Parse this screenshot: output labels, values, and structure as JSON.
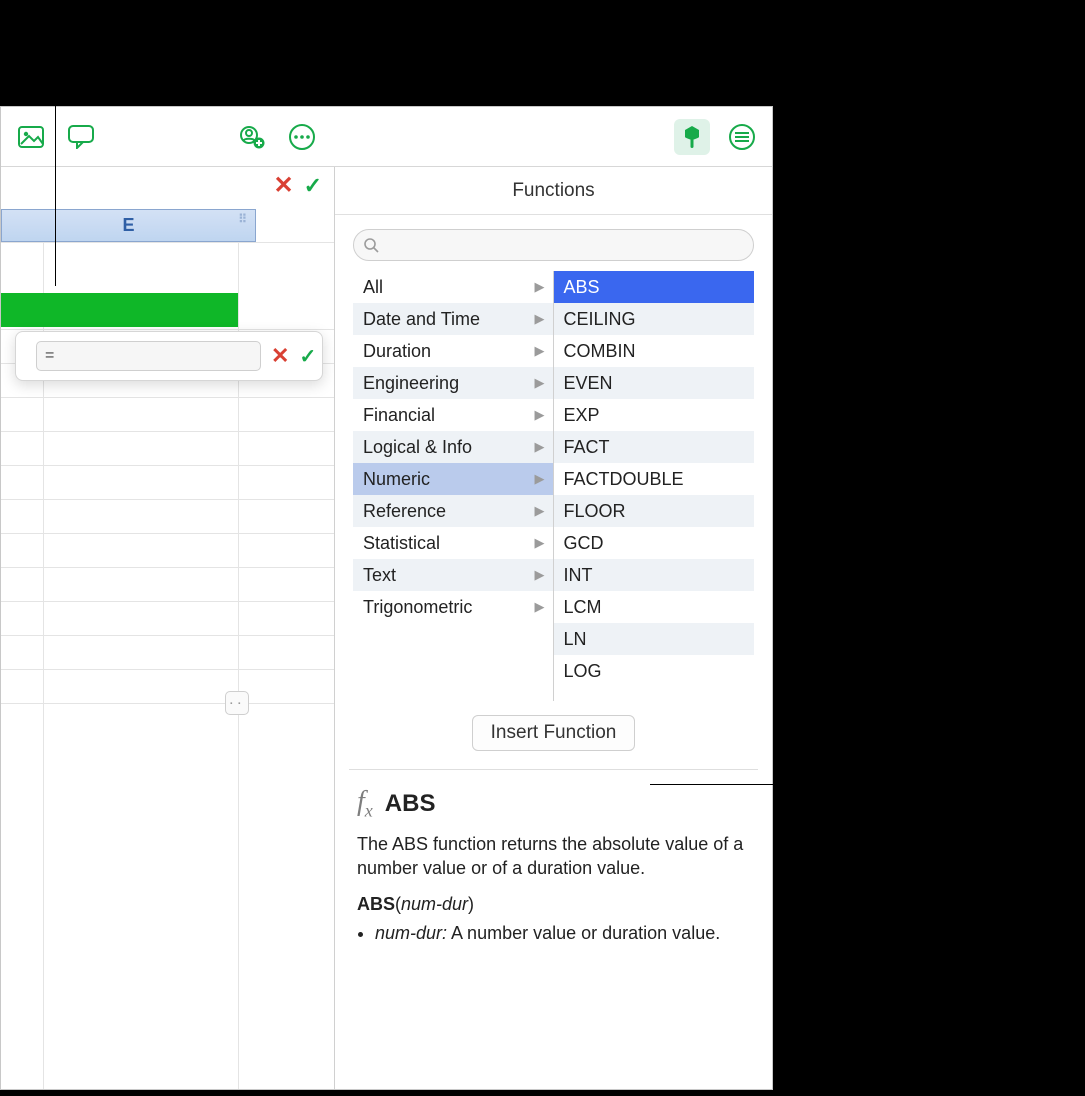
{
  "toolbar": {
    "icons": [
      "media-icon",
      "comment-icon",
      "share-icon",
      "more-icon",
      "format-icon",
      "panels-icon"
    ]
  },
  "sheet": {
    "column_label": "E",
    "formula_value": "="
  },
  "panel": {
    "title": "Functions",
    "search_placeholder": "",
    "categories": [
      "All",
      "Date and Time",
      "Duration",
      "Engineering",
      "Financial",
      "Logical & Info",
      "Numeric",
      "Reference",
      "Statistical",
      "Text",
      "Trigonometric"
    ],
    "selected_category_index": 6,
    "functions": [
      "ABS",
      "CEILING",
      "COMBIN",
      "EVEN",
      "EXP",
      "FACT",
      "FACTDOUBLE",
      "FLOOR",
      "GCD",
      "INT",
      "LCM",
      "LN",
      "LOG"
    ],
    "selected_function_index": 0,
    "insert_label": "Insert Function",
    "detail": {
      "name": "ABS",
      "summary": "The ABS function returns the absolute value of a number value or of a duration value.",
      "signature_func": "ABS",
      "signature_arg": "num-dur",
      "arg_name": "num-dur:",
      "arg_desc": "A number value or duration value."
    }
  }
}
